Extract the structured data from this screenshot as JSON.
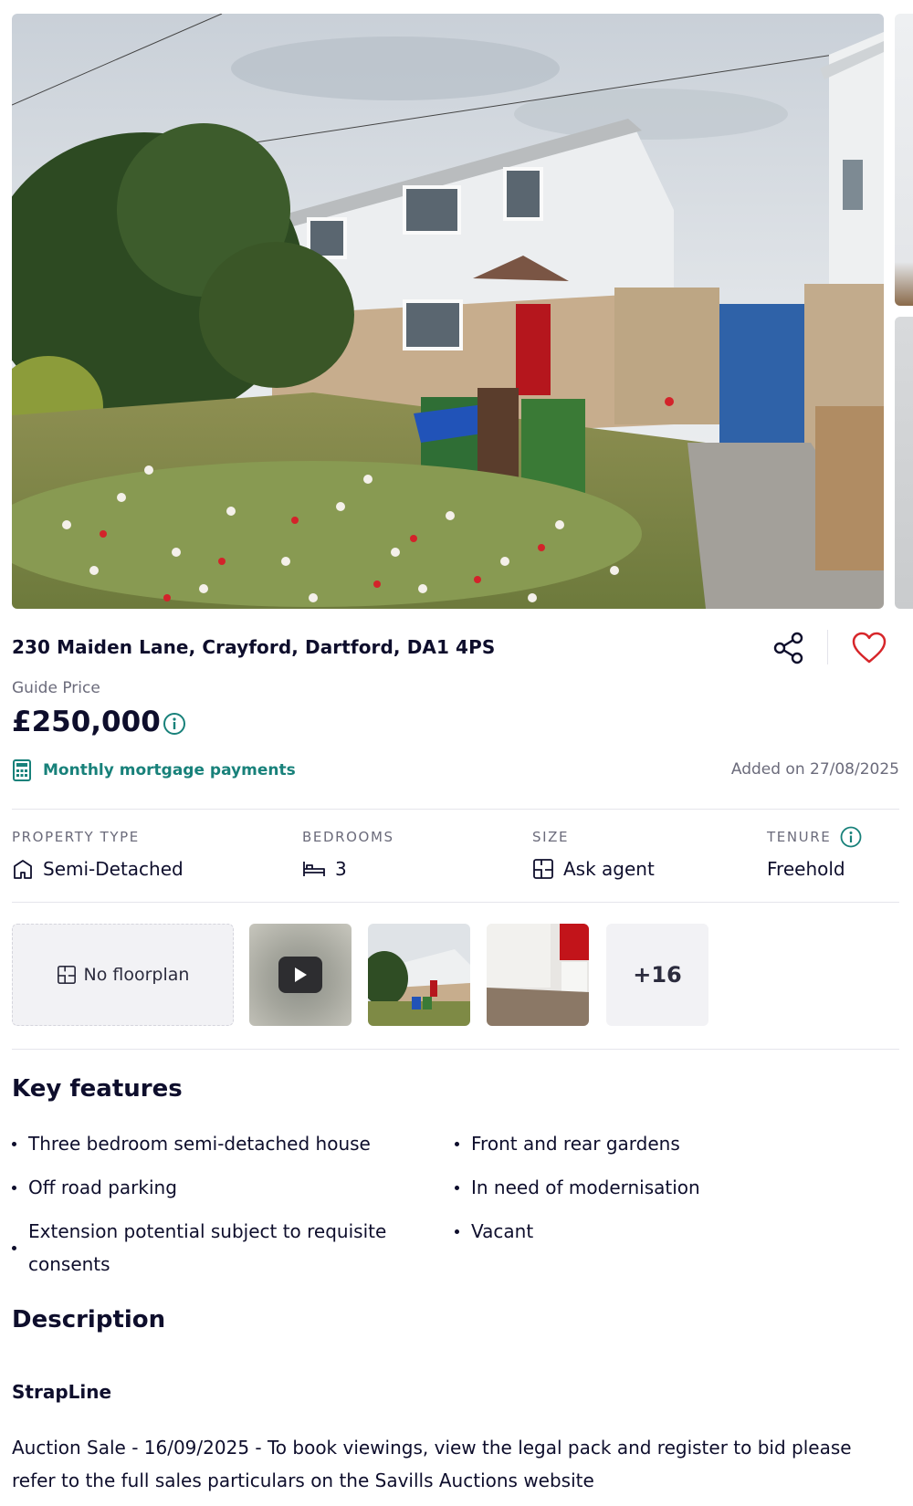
{
  "listing": {
    "address": "230 Maiden Lane, Crayford, Dartford, DA1 4PS",
    "guide_label": "Guide Price",
    "price": "£250,000",
    "mortgage_link": "Monthly mortgage payments",
    "added": "Added on 27/08/2025"
  },
  "property_info": {
    "type_label": "PROPERTY TYPE",
    "type_value": "Semi-Detached",
    "bedrooms_label": "BEDROOMS",
    "bedrooms_value": "3",
    "size_label": "SIZE",
    "size_value": "Ask agent",
    "tenure_label": "TENURE",
    "tenure_value": "Freehold"
  },
  "media": {
    "floorplan_label": "No floorplan",
    "more_label": "+16"
  },
  "key_features": {
    "title": "Key features",
    "left": [
      "Three bedroom semi-detached house",
      "Off road parking",
      "Extension potential subject to requisite consents"
    ],
    "right": [
      "Front and rear gardens",
      "In need of modernisation",
      "Vacant"
    ]
  },
  "description": {
    "title": "Description",
    "subtitle": "StrapLine",
    "text": "Auction Sale - 16/09/2025 - To book viewings, view the legal pack and register to bid please refer to the full sales particulars on the Savills Auctions website"
  },
  "colors": {
    "accent": "#18817a",
    "heart": "#d7262a",
    "text": "#0e0e2c",
    "muted": "#6b6b7b"
  }
}
